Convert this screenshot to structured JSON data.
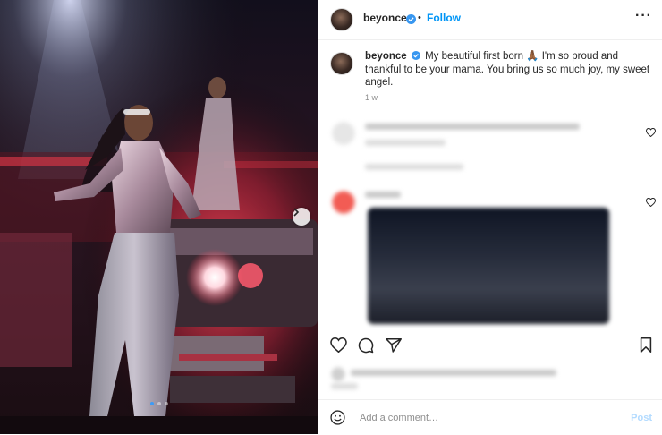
{
  "post": {
    "username": "beyonce",
    "follow_label": "Follow",
    "more_icon": "more-options-icon",
    "caption_text": "My beautiful first born 🙏🏾 I'm so proud and thankful to be your mama. You bring us so much joy, my sweet angel.",
    "age": "1 w",
    "slides": {
      "count": 3,
      "active": 1
    }
  },
  "actions": {
    "like_icon": "heart-icon",
    "comment_icon": "comment-icon",
    "share_icon": "send-icon",
    "save_icon": "bookmark-icon"
  },
  "comment_box": {
    "placeholder": "Add a comment…",
    "post_label": "Post"
  },
  "colors": {
    "accent": "#0095f6",
    "verified": "#3897f0",
    "post_disabled": "#b3dbff"
  }
}
